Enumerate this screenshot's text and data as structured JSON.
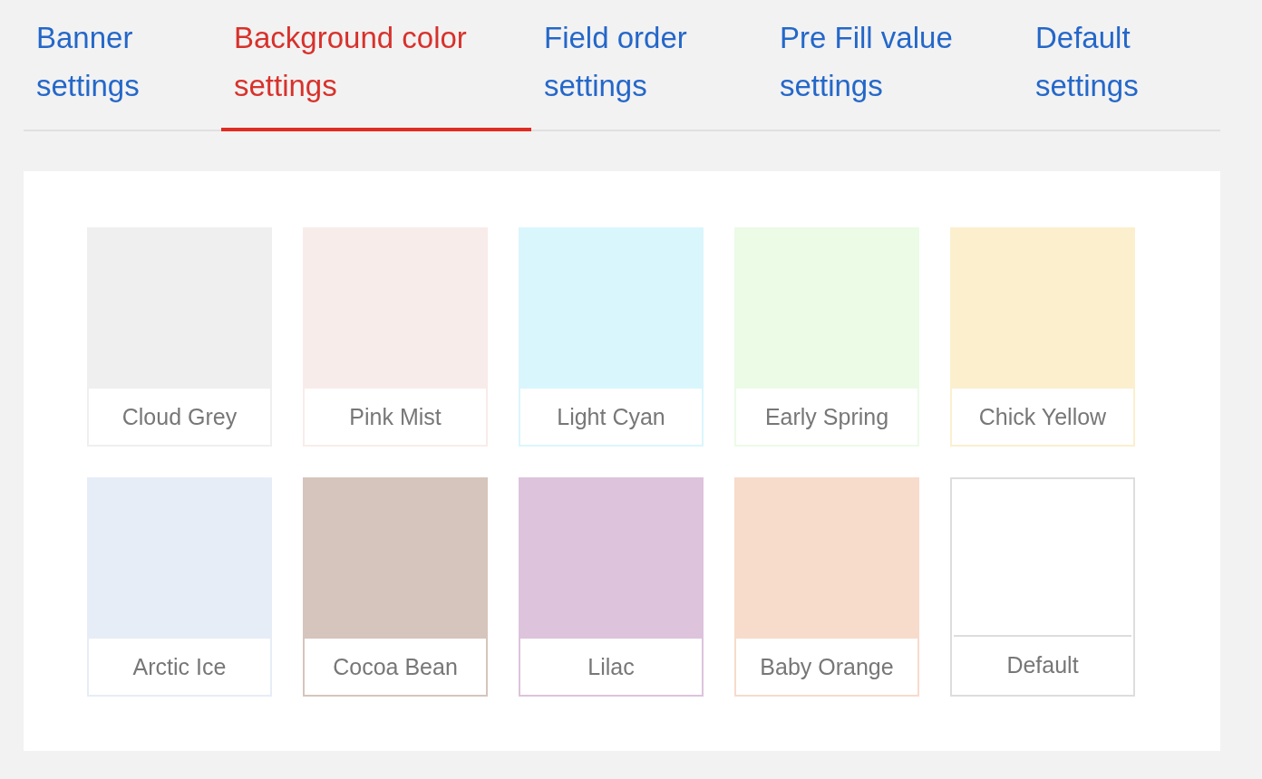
{
  "tabs": [
    {
      "label": "Banner settings",
      "selected": false
    },
    {
      "label": "Background color settings",
      "selected": true
    },
    {
      "label": "Field order settings",
      "selected": false
    },
    {
      "label": "Pre Fill value settings",
      "selected": false
    },
    {
      "label": "Default settings",
      "selected": false
    }
  ],
  "swatches": [
    {
      "name": "Cloud Grey",
      "color": "#efefef"
    },
    {
      "name": "Pink Mist",
      "color": "#f8ecea"
    },
    {
      "name": "Light Cyan",
      "color": "#daf6fd"
    },
    {
      "name": "Early Spring",
      "color": "#ebfbe6"
    },
    {
      "name": "Chick Yellow",
      "color": "#fbefce"
    },
    {
      "name": "Arctic Ice",
      "color": "#e6edf7"
    },
    {
      "name": "Cocoa Bean",
      "color": "#d6c5bc"
    },
    {
      "name": "Lilac",
      "color": "#ddc3dc"
    },
    {
      "name": "Baby Orange",
      "color": "#f7dbcb"
    },
    {
      "name": "Default",
      "color": "#ffffff"
    }
  ]
}
